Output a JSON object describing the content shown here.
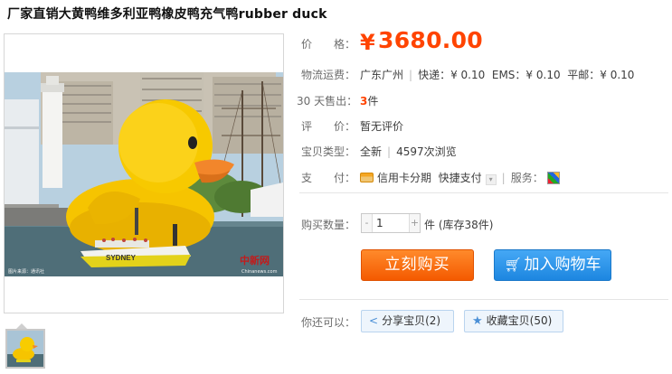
{
  "product": {
    "title": "厂家直销大黄鸭维多利亚鸭橡皮鸭充气鸭rubber duck"
  },
  "image": {
    "main_alt": "giant yellow rubber duck in harbor",
    "watermark_left": "Chinanews.com",
    "watermark_caption": "图片来源：通讯社",
    "watermark_logo": "中新网",
    "boat_text": "SYDNEY"
  },
  "price": {
    "label": "价　　格：",
    "currency": "¥",
    "amount": "3680.00"
  },
  "shipping": {
    "label": "物流运费：",
    "location": "广东广州",
    "express": "快递：¥ 0.10",
    "ems": "EMS：¥ 0.10",
    "mail": "平邮：¥ 0.10"
  },
  "sales": {
    "label": "30 天售出：",
    "count": "3",
    "unit": "件"
  },
  "rating": {
    "label": "评　　价：",
    "value": "暂无评价"
  },
  "item_type": {
    "label": "宝贝类型：",
    "condition": "全新",
    "views": "4597次浏览"
  },
  "payment": {
    "label": "支　　付：",
    "installment": "信用卡分期",
    "quick_pay": "快捷支付",
    "service_label": "服务："
  },
  "quantity": {
    "label": "购买数量：",
    "minus": "-",
    "plus": "+",
    "value": "1",
    "stock_text": "件 (库存38件)"
  },
  "actions": {
    "buy_now": "立刻购买",
    "add_cart": "加入购物车",
    "cart_icon": "cart-icon"
  },
  "social": {
    "label": "你还可以：",
    "share": "分享宝贝(2)",
    "favorite": "收藏宝贝(50)"
  },
  "colors": {
    "price": "#ff4400",
    "buy_button": "#f45a00",
    "cart_button": "#1d86e0",
    "duck_yellow": "#f6c400"
  }
}
